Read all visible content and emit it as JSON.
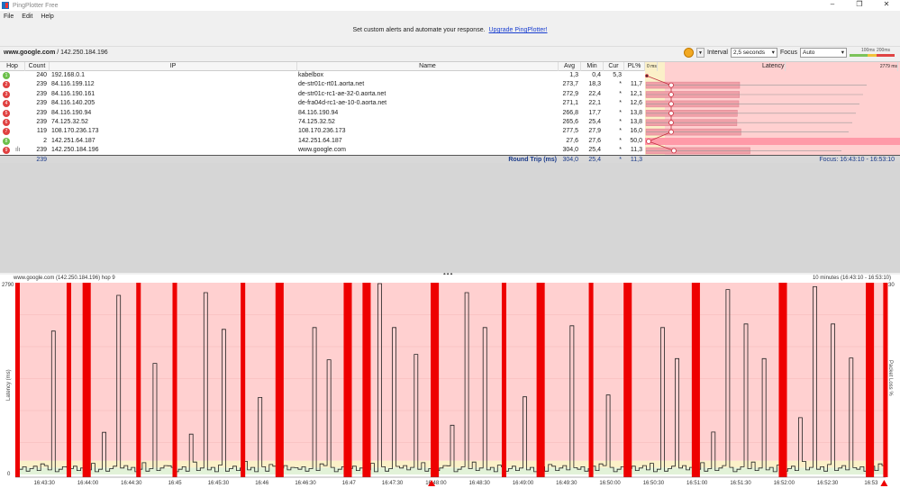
{
  "window": {
    "title": "PingPlotter Free",
    "controls": [
      "–",
      "❐",
      "✕"
    ]
  },
  "menu": [
    "File",
    "Edit",
    "Help"
  ],
  "banner": {
    "text": "Set custom alerts and automate your response.",
    "link": "Upgrade PingPlotter!"
  },
  "address": {
    "host": "www.google.com",
    "ip": " / 142.250.184.196"
  },
  "toolbar": {
    "interval_label": "Interval",
    "interval_value": "2,5 seconds",
    "focus_label": "Focus",
    "focus_value": "Auto",
    "scale_low": "100ms",
    "scale_high": "200ms",
    "pause_color": "#f2a922"
  },
  "table": {
    "headers": {
      "hop": "Hop",
      "count": "Count",
      "ip": "IP",
      "name": "Name",
      "avg": "Avg",
      "min": "Min",
      "cur": "Cur",
      "pl": "PL%",
      "lat_min": "0 ms",
      "latency": "Latency",
      "lat_max": "2779 ms"
    },
    "rows": [
      {
        "hop": "1",
        "status": "good",
        "count": "240",
        "ip": "192.168.0.1",
        "name": "kabelbox",
        "avg": "1,3",
        "min": "0,4",
        "cur": "5,3",
        "pl": "",
        "avgv": 1.3,
        "plv": 0
      },
      {
        "hop": "2",
        "status": "bad",
        "count": "239",
        "ip": "84.116.199.112",
        "name": "de-str01c-rt01.aorta.net",
        "avg": "273,7",
        "min": "18,3",
        "cur": "*",
        "pl": "11,7",
        "avgv": 273.7,
        "plv": 11.7
      },
      {
        "hop": "3",
        "status": "bad",
        "count": "239",
        "ip": "84.116.190.161",
        "name": "de-str01c-rc1-ae-32-0.aorta.net",
        "avg": "272,9",
        "min": "22,4",
        "cur": "*",
        "pl": "12,1",
        "avgv": 272.9,
        "plv": 12.1
      },
      {
        "hop": "4",
        "status": "bad",
        "count": "239",
        "ip": "84.116.140.205",
        "name": "de-fra04d-rc1-ae-10-0.aorta.net",
        "avg": "271,1",
        "min": "22,1",
        "cur": "*",
        "pl": "12,6",
        "avgv": 271.1,
        "plv": 12.6
      },
      {
        "hop": "5",
        "status": "bad",
        "count": "239",
        "ip": "84.116.190.94",
        "name": "84.116.190.94",
        "avg": "266,8",
        "min": "17,7",
        "cur": "*",
        "pl": "13,8",
        "avgv": 266.8,
        "plv": 13.8
      },
      {
        "hop": "6",
        "status": "bad",
        "count": "239",
        "ip": "74.125.32.52",
        "name": "74.125.32.52",
        "avg": "265,6",
        "min": "25,4",
        "cur": "*",
        "pl": "13,8",
        "avgv": 265.6,
        "plv": 13.8
      },
      {
        "hop": "7",
        "status": "bad",
        "count": "119",
        "ip": "108.170.236.173",
        "name": "108.170.236.173",
        "avg": "277,5",
        "min": "27,9",
        "cur": "*",
        "pl": "16,0",
        "avgv": 277.5,
        "plv": 16.0
      },
      {
        "hop": "8",
        "status": "good",
        "count": "2",
        "ip": "142.251.64.187",
        "name": "142.251.64.187",
        "avg": "27,6",
        "min": "27,6",
        "cur": "*",
        "pl": "50,0",
        "avgv": 27.6,
        "plv": 50.0
      },
      {
        "hop": "9",
        "status": "bad",
        "count": "239",
        "ip": "142.250.184.196",
        "name": "www.google.com",
        "avg": "304,0",
        "min": "25,4",
        "cur": "*",
        "pl": "11,3",
        "avgv": 304.0,
        "plv": 11.3
      }
    ],
    "summary": {
      "count": "239",
      "label": "Round Trip (ms)",
      "avg": "304,0",
      "min": "25,4",
      "cur": "*",
      "pl": "11,3",
      "focus": "Focus: 16:43:10 - 16:53:10"
    }
  },
  "graph": {
    "title": "www.google.com (142.250.184.196) hop 9",
    "range": "10 minutes (16:43:10 - 16:53:10)",
    "ylabel": "Latency (ms)",
    "y2label": "Packet Loss %",
    "ymax_label": "2790",
    "ymin_label": "0",
    "y2max_label": "30",
    "colors": {
      "bad": "#ffd0d0",
      "warn": "#fbf0c8",
      "good": "#e2f2d8",
      "loss": "#ee0000"
    }
  },
  "chart_data": {
    "type": "line",
    "duration_s": 600,
    "ylim": [
      0,
      2790
    ],
    "xticks": [
      "16:43:30",
      "16:44:00",
      "16:44:30",
      "16:45",
      "16:45:30",
      "16:46",
      "16:46:30",
      "16:47",
      "16:47:30",
      "16:48:00",
      "16:48:30",
      "16:49:00",
      "16:49:30",
      "16:50:00",
      "16:50:30",
      "16:51:00",
      "16:51:30",
      "16:52:00",
      "16:52:30",
      "16:53"
    ],
    "spikes": [
      [
        24,
        2086
      ],
      [
        61,
        613
      ],
      [
        71,
        2607
      ],
      [
        96,
        1616
      ],
      [
        121,
        587
      ],
      [
        131,
        2646
      ],
      [
        143,
        2112
      ],
      [
        168,
        1121
      ],
      [
        204,
        2138
      ],
      [
        216,
        1669
      ],
      [
        251,
        2777
      ],
      [
        261,
        2138
      ],
      [
        276,
        1747
      ],
      [
        301,
        717
      ],
      [
        311,
        2646
      ],
      [
        323,
        2138
      ],
      [
        349,
        1130
      ],
      [
        383,
        2164
      ],
      [
        408,
        1156
      ],
      [
        444,
        2138
      ],
      [
        456,
        1686
      ],
      [
        481,
        617
      ],
      [
        491,
        2690
      ],
      [
        503,
        2190
      ],
      [
        516,
        1686
      ],
      [
        541,
        826
      ],
      [
        551,
        2733
      ],
      [
        563,
        2190
      ],
      [
        576,
        1695
      ]
    ],
    "loss": [
      [
        0.6,
        2.5
      ],
      [
        36,
        2.5
      ],
      [
        47,
        5
      ],
      [
        84,
        2.5
      ],
      [
        109,
        2.5
      ],
      [
        156,
        2.5
      ],
      [
        180,
        5
      ],
      [
        227,
        5
      ],
      [
        240,
        5
      ],
      [
        287,
        5
      ],
      [
        336,
        2.5
      ],
      [
        360,
        5
      ],
      [
        396,
        2.5
      ],
      [
        420,
        5
      ],
      [
        467,
        5
      ],
      [
        527,
        5
      ],
      [
        587,
        5
      ],
      [
        599,
        2.5
      ]
    ],
    "alerts_s": [
      287,
      599
    ]
  }
}
